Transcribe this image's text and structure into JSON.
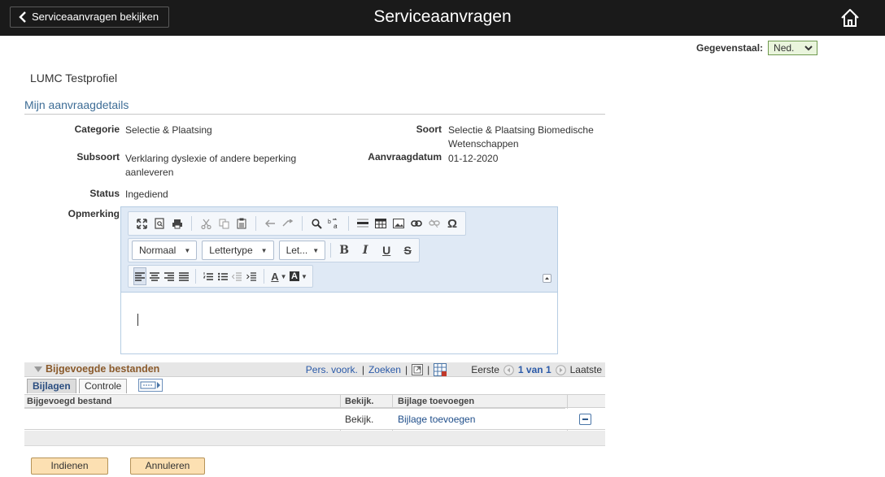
{
  "header": {
    "back_label": "Serviceaanvragen bekijken",
    "title": "Serviceaanvragen",
    "home_icon": "home-icon",
    "colors": {
      "bar": "#1a1a1a",
      "text": "#ffffff"
    }
  },
  "data_language": {
    "label": "Gegevenstaal:",
    "value": "Ned."
  },
  "profile_name": "LUMC Testprofiel",
  "section_title": "Mijn aanvraagdetails",
  "details": {
    "categorie_label": "Categorie",
    "categorie_value": "Selectie & Plaatsing",
    "soort_label": "Soort",
    "soort_value_line1": "Selectie & Plaatsing Biomedische",
    "soort_value_line2": "Wetenschappen",
    "subsoort_label": "Subsoort",
    "subsoort_value_line1": "Verklaring dyslexie of andere beperking",
    "subsoort_value_line2": "aanleveren",
    "aanvraagdatum_label": "Aanvraagdatum",
    "aanvraagdatum_value": "01-12-2020",
    "status_label": "Status",
    "status_value": "Ingediend",
    "opmerking_label": "Opmerking"
  },
  "editor": {
    "toolbar_icons_row1": [
      "maximize-icon",
      "preview-icon",
      "print-icon",
      "cut-icon",
      "copy-icon",
      "paste-icon",
      "undo-icon",
      "redo-icon",
      "find-icon",
      "replace-icon",
      "horizontal-rule-icon",
      "table-icon",
      "image-icon",
      "link-icon",
      "unlink-icon",
      "special-character-icon"
    ],
    "format_combo": "Normaal",
    "font_combo": "Lettertype",
    "size_combo": "Let...",
    "bold": "B",
    "italic": "I",
    "underline": "U",
    "strike": "S",
    "special_char": "Ω",
    "text_color_letter": "A",
    "bg_color_letter": "A",
    "content": ""
  },
  "attachments": {
    "title": "Bijgevoegde bestanden",
    "personalize": "Pers. voork.",
    "search": "Zoeken",
    "separator": "|",
    "first": "Eerste",
    "page_info": "1 van 1",
    "last": "Laatste",
    "tabs": [
      "Bijlagen",
      "Controle"
    ],
    "columns": [
      "Bijgevoegd bestand",
      "Bekijk.",
      "Bijlage toevoegen"
    ],
    "rows": [
      {
        "file": "",
        "view": "Bekijk.",
        "add": "Bijlage toevoegen"
      }
    ]
  },
  "buttons": {
    "submit": "Indienen",
    "cancel": "Annuleren"
  }
}
